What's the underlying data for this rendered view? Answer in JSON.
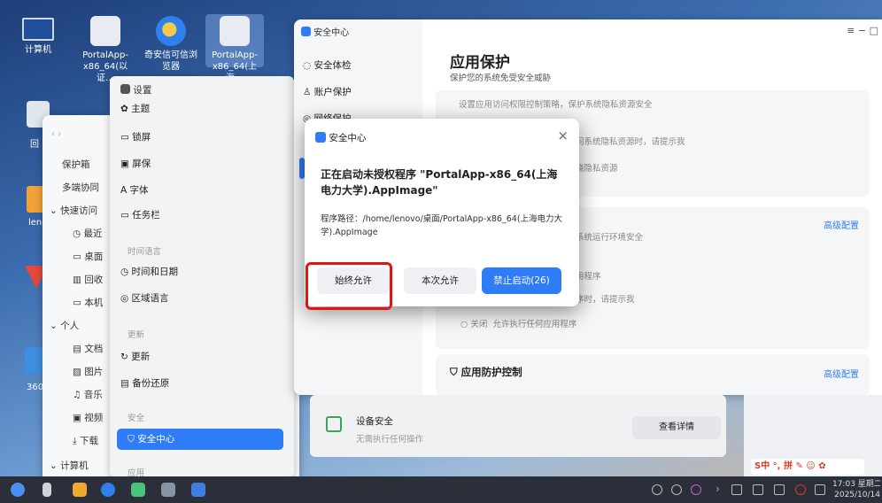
{
  "desktop": {
    "icons": [
      {
        "label": "计算机"
      },
      {
        "label": "PortalApp-x86_64(以证…"
      },
      {
        "label": "奇安信可信浏览器"
      },
      {
        "label": "PortalApp-x86_64(上海…"
      },
      {
        "label": "回"
      },
      {
        "label": "len"
      },
      {
        "label": "360"
      }
    ]
  },
  "file_manager": {
    "items": [
      "保护箱",
      "多端协同",
      "快速访问",
      "最近",
      "桌面",
      "回收",
      "本机",
      "个人",
      "文档",
      "图片",
      "音乐",
      "视频",
      "下载",
      "计算机"
    ]
  },
  "settings": {
    "title": "设置",
    "items": [
      "主题",
      "锁屏",
      "屏保",
      "字体",
      "任务栏"
    ],
    "group_time": "时间语言",
    "time_items": [
      "时间和日期",
      "区域语言"
    ],
    "group_update": "更新",
    "update_items": [
      "更新",
      "备份还原"
    ],
    "group_security": "安全",
    "active_item": "安全中心",
    "group_app": "应用"
  },
  "security_center": {
    "title": "安全中心",
    "nav": [
      "安全体检",
      "账户保护",
      "网络保护"
    ],
    "page_title": "应用保护",
    "page_subtitle": "保护您的系统免受安全威胁",
    "section_desc": "设置应用访问权限控制策略，保护系统隐私资源安全",
    "hint1": "问系统隐私资源时，请提示我",
    "hint2": "绕隐私资源",
    "hint3": "系统运行环境安全",
    "hint4": "用程序",
    "hint5": "序时，请提示我",
    "off_label": "关闭",
    "off_desc": "允许执行任何应用程序",
    "advanced1": "高级配置",
    "app_control": "应用防护控制",
    "advanced2": "高级配置",
    "device_title": "设备安全",
    "device_desc": "无需执行任何操作",
    "view_details": "查看详情",
    "window_controls": "≡  −  □"
  },
  "dialog": {
    "title": "安全中心",
    "close": "×",
    "message": "正在启动未授权程序 \"PortalApp-x86_64(上海电力大学).AppImage\"",
    "path": "程序路径：/home/lenovo/桌面/PortalApp-x86_64(上海电力大学).AppImage",
    "btn_always": "始终允许",
    "btn_once": "本次允许",
    "btn_block": "禁止启动(26)"
  },
  "ime": {
    "label": "S中 °, 拼 ✎ ☺ ✿"
  },
  "taskbar": {
    "time": "17:03 星期二",
    "date": "2025/10/14"
  },
  "colors": {
    "accent": "#2e7cf6",
    "highlight": "#e01414"
  }
}
